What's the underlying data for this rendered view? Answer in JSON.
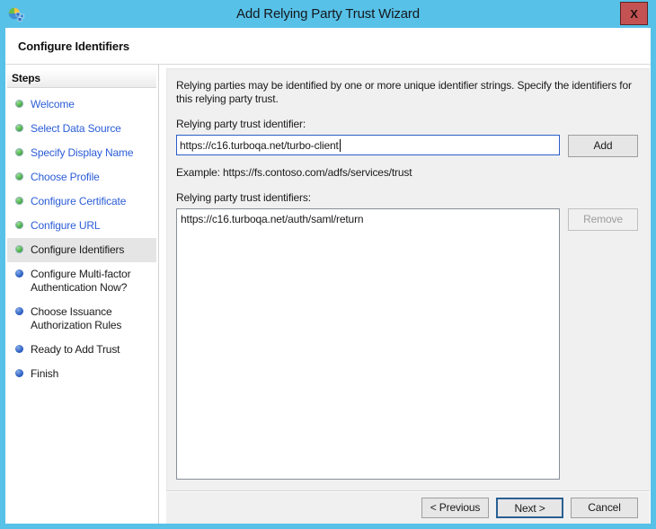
{
  "window": {
    "title": "Add Relying Party Trust Wizard",
    "close_glyph": "X"
  },
  "heading": "Configure Identifiers",
  "sidebar": {
    "header": "Steps",
    "items": [
      {
        "label": "Welcome",
        "state": "completed"
      },
      {
        "label": "Select Data Source",
        "state": "completed"
      },
      {
        "label": "Specify Display Name",
        "state": "completed"
      },
      {
        "label": "Choose Profile",
        "state": "completed"
      },
      {
        "label": "Configure Certificate",
        "state": "completed"
      },
      {
        "label": "Configure URL",
        "state": "completed"
      },
      {
        "label": "Configure Identifiers",
        "state": "current"
      },
      {
        "label": "Configure Multi-factor Authentication Now?",
        "state": "upcoming"
      },
      {
        "label": "Choose Issuance Authorization Rules",
        "state": "upcoming"
      },
      {
        "label": "Ready to Add Trust",
        "state": "upcoming"
      },
      {
        "label": "Finish",
        "state": "upcoming"
      }
    ]
  },
  "content": {
    "description": "Relying parties may be identified by one or more unique identifier strings. Specify the identifiers for this relying party trust.",
    "identifier_label": "Relying party trust identifier:",
    "identifier_input": {
      "value": "https://c16.turboqa.net/turbo-client",
      "placeholder": ""
    },
    "add_button": "Add",
    "example_text": "Example: https://fs.contoso.com/adfs/services/trust",
    "identifiers_list_label": "Relying party trust identifiers:",
    "identifiers": [
      "https://c16.turboqa.net/auth/saml/return"
    ],
    "remove_button": "Remove",
    "remove_button_enabled": false
  },
  "footer": {
    "previous_button": "< Previous",
    "next_button": "Next >",
    "cancel_button": "Cancel"
  },
  "colors": {
    "window_frame": "#57C1E8",
    "close_button_bg": "#C45252",
    "panel_bg": "#F0F0F0",
    "step_link_blue": "#2B5DD7",
    "step_done_dot_green": "#3FA83C",
    "step_upcoming_dot_blue": "#2E62C4",
    "current_step_bg": "#E5E5E5",
    "focused_input_border": "#2B5DC9",
    "default_button_border": "#2A5F93"
  }
}
